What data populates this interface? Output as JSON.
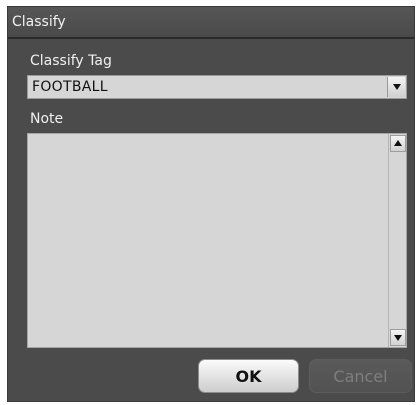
{
  "dialog": {
    "title": "Classify"
  },
  "classify_tag": {
    "label": "Classify Tag",
    "selected_value": "FOOTBALL"
  },
  "note": {
    "label": "Note",
    "value": ""
  },
  "buttons": {
    "ok_label": "OK",
    "cancel_label": "Cancel",
    "cancel_disabled": true
  },
  "icons": {
    "dropdown": "chevron-down-icon",
    "scroll_up": "scroll-up-arrow-icon",
    "scroll_down": "scroll-down-arrow-icon"
  },
  "colors": {
    "dialog_background": "#4b4b4b",
    "field_background": "#d6d6d6",
    "text_light": "#f0f0f0",
    "disabled_text": "#7e7e7e"
  }
}
